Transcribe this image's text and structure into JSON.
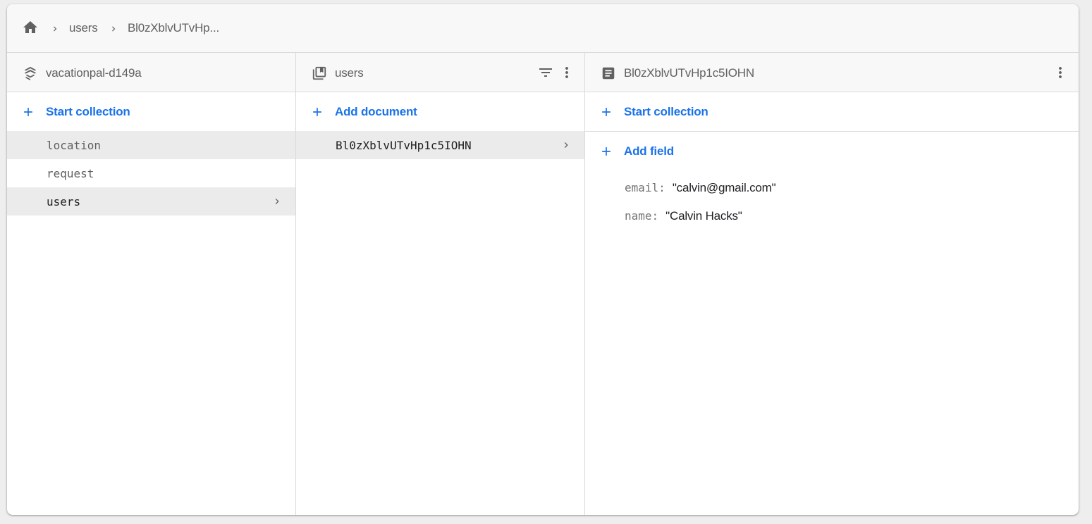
{
  "breadcrumb": {
    "home_icon": "home-icon",
    "items": [
      "users",
      "Bl0zXblvUTvHp..."
    ]
  },
  "columns": {
    "root": {
      "title": "vacationpal-d149a",
      "icon": "firestore-database-icon",
      "action_label": "Start collection",
      "collections": [
        {
          "name": "location",
          "selected": false
        },
        {
          "name": "request",
          "selected": false
        },
        {
          "name": "users",
          "selected": true
        }
      ]
    },
    "collection": {
      "title": "users",
      "icon": "collection-icon",
      "action_label": "Add document",
      "documents": [
        {
          "id": "Bl0zXblvUTvHp1c5IOHN",
          "selected": true
        }
      ]
    },
    "document": {
      "title": "Bl0zXblvUTvHp1c5IOHN",
      "icon": "document-icon",
      "action_label": "Start collection",
      "add_field_label": "Add field",
      "fields": [
        {
          "key": "email",
          "value": "\"calvin@gmail.com\""
        },
        {
          "key": "name",
          "value": "\"Calvin Hacks\""
        }
      ]
    }
  },
  "colors": {
    "accent": "#1a73e8",
    "selected_row": "#ebebeb",
    "header_bg": "#f8f8f8",
    "icon_gray": "#616161"
  }
}
